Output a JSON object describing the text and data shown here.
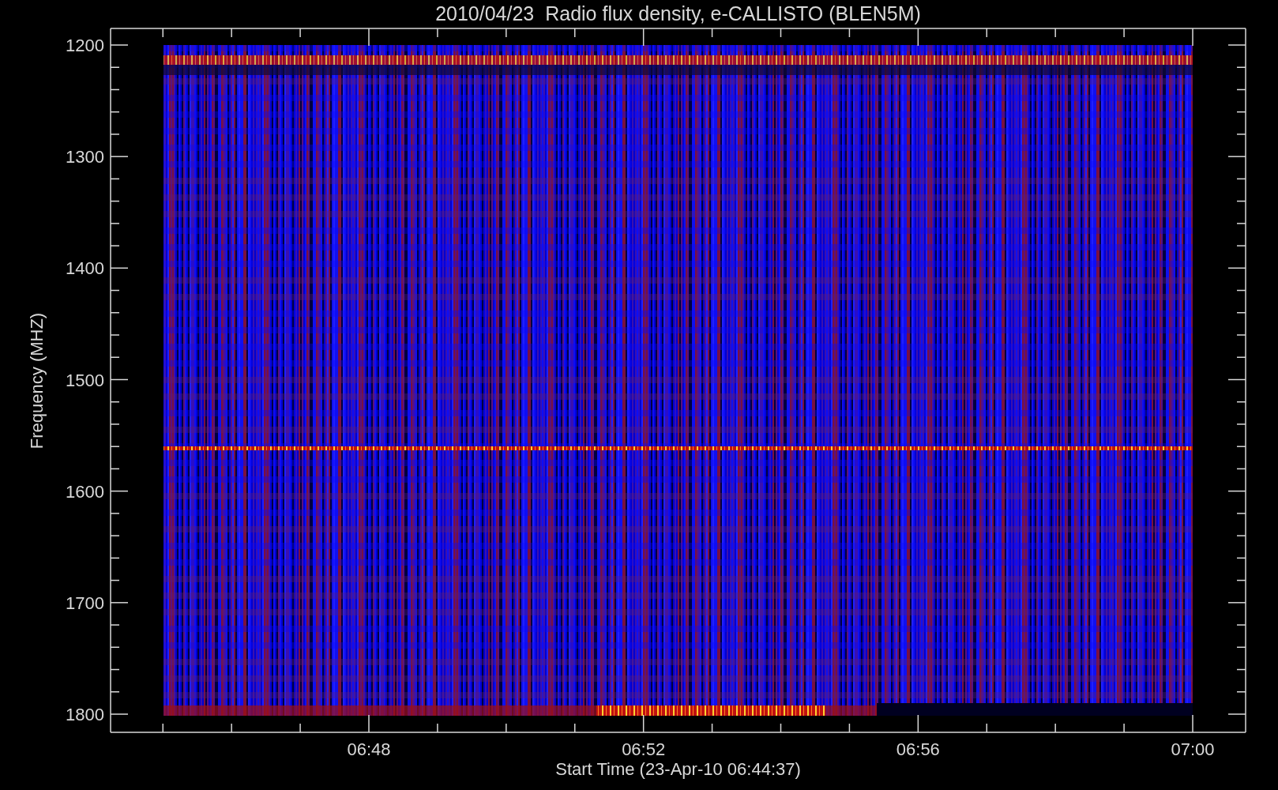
{
  "plot": {
    "title": "2010/04/23  Radio flux density, e-CALLISTO (BLEN5M)",
    "ylabel": "Frequency (MHZ)",
    "xlabel": "Start Time (23-Apr-10 06:44:37)",
    "yticks": [
      "1200",
      "1300",
      "1400",
      "1500",
      "1600",
      "1700",
      "1800"
    ],
    "xticks": [
      "06:48",
      "06:52",
      "06:56",
      "07:00"
    ]
  }
}
